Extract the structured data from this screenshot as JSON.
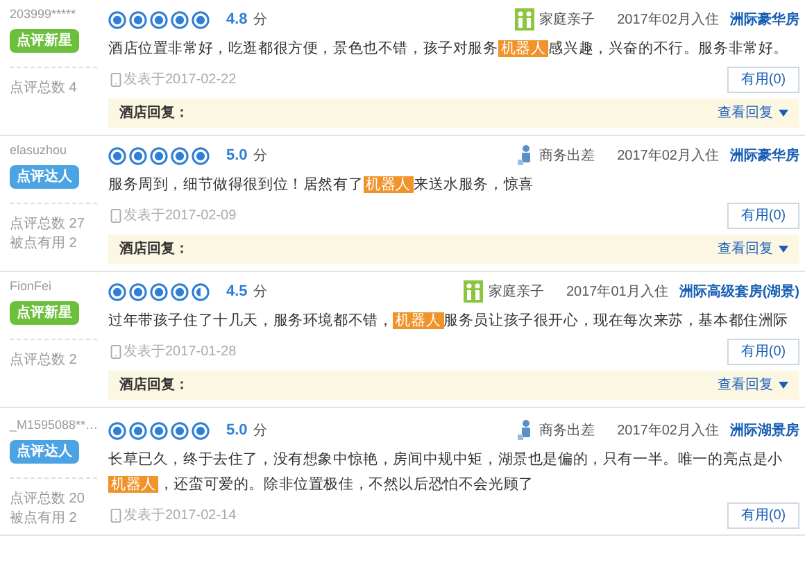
{
  "reviews": [
    {
      "user": "203999*****",
      "badge": {
        "kind": "new_star",
        "label": "点评新星"
      },
      "stats": [
        "点评总数 4"
      ],
      "stars": 5,
      "score": "4.8",
      "score_unit": "分",
      "trip": {
        "kind": "family",
        "label": "家庭亲子"
      },
      "stay": "2017年02月入住",
      "room": "洲际豪华房",
      "text": [
        {
          "text": "酒店位置非常好，吃逛都很方便，景色也不错，孩子对服务",
          "highlight": false
        },
        {
          "text": "机器人",
          "highlight": true
        },
        {
          "text": "感兴趣，兴奋的不行。服务非常好。",
          "highlight": false
        }
      ],
      "posted": "发表于2017-02-22",
      "helpful": "有用(0)",
      "reply": {
        "label": "酒店回复：",
        "toggle": "查看回复"
      }
    },
    {
      "user": "elasuzhou",
      "badge": {
        "kind": "expert",
        "label": "点评达人"
      },
      "stats": [
        "点评总数 27",
        "被点有用 2"
      ],
      "stars": 5,
      "score": "5.0",
      "score_unit": "分",
      "trip": {
        "kind": "business",
        "label": "商务出差"
      },
      "stay": "2017年02月入住",
      "room": "洲际豪华房",
      "text": [
        {
          "text": "服务周到，细节做得很到位！居然有了",
          "highlight": false
        },
        {
          "text": "机器人",
          "highlight": true
        },
        {
          "text": "来送水服务，惊喜",
          "highlight": false
        }
      ],
      "posted": "发表于2017-02-09",
      "helpful": "有用(0)",
      "reply": {
        "label": "酒店回复：",
        "toggle": "查看回复"
      }
    },
    {
      "user": "FionFei",
      "badge": {
        "kind": "new_star",
        "label": "点评新星"
      },
      "stats": [
        "点评总数 2"
      ],
      "stars": 4.5,
      "score": "4.5",
      "score_unit": "分",
      "trip": {
        "kind": "family",
        "label": "家庭亲子"
      },
      "stay": "2017年01月入住",
      "room": "洲际高级套房(湖景)",
      "text": [
        {
          "text": "过年带孩子住了十几天，服务环境都不错，",
          "highlight": false
        },
        {
          "text": "机器人",
          "highlight": true
        },
        {
          "text": "服务员让孩子很开心，现在每次来苏，基本都住洲际",
          "highlight": false
        }
      ],
      "posted": "发表于2017-01-28",
      "helpful": "有用(0)",
      "reply": {
        "label": "酒店回复：",
        "toggle": "查看回复"
      }
    },
    {
      "user": "_M1595088**…",
      "badge": {
        "kind": "expert",
        "label": "点评达人"
      },
      "stats": [
        "点评总数 20",
        "被点有用 2"
      ],
      "stars": 5,
      "score": "5.0",
      "score_unit": "分",
      "trip": {
        "kind": "business",
        "label": "商务出差"
      },
      "stay": "2017年02月入住",
      "room": "洲际湖景房",
      "text": [
        {
          "text": "长草已久，终于去住了，没有想象中惊艳，房间中规中矩，湖景也是偏的，只有一半。唯一的亮点是小",
          "highlight": false
        },
        {
          "text": "机器人",
          "highlight": true
        },
        {
          "text": "，还蛮可爱的。除非位置极佳，不然以后恐怕不会光顾了",
          "highlight": false
        }
      ],
      "posted": "发表于2017-02-14",
      "helpful": "有用(0)"
    }
  ]
}
